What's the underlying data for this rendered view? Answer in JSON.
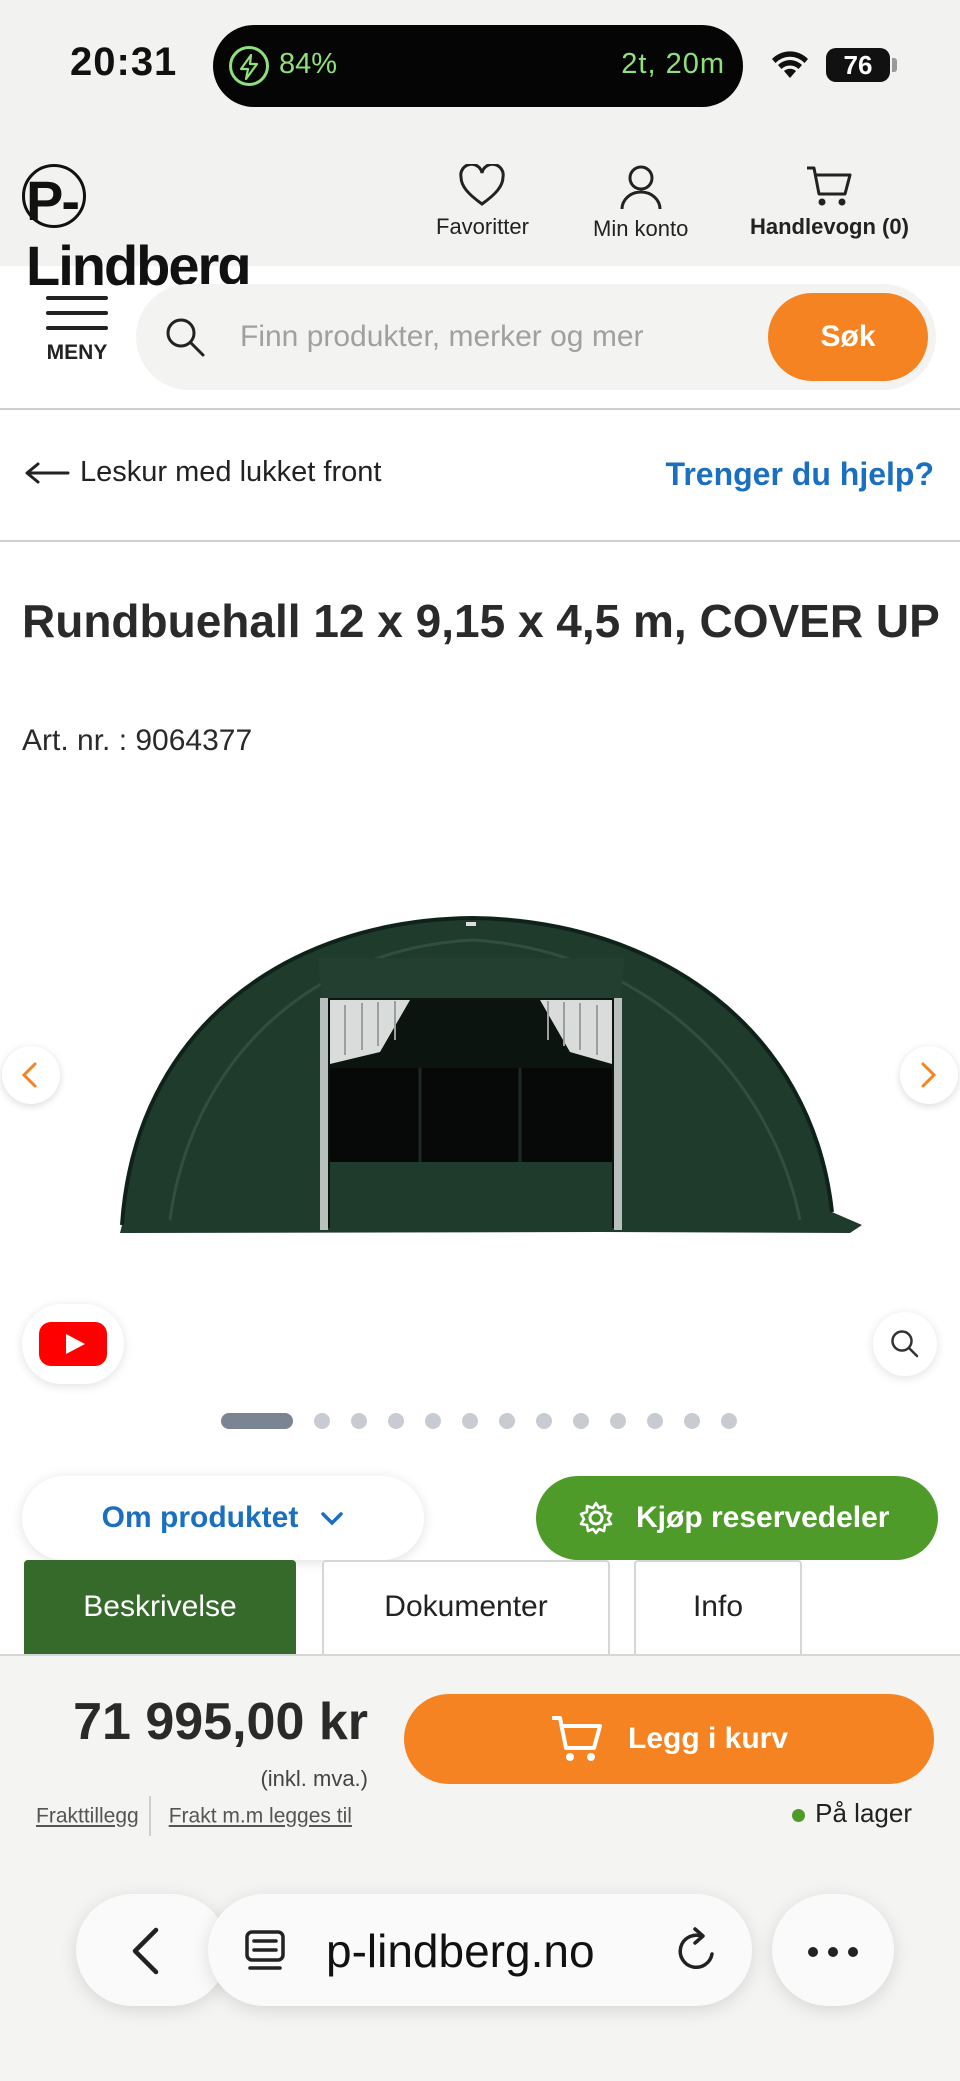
{
  "status_bar": {
    "time": "20:31",
    "activity_battery": "84%",
    "activity_time": "2t, 20m",
    "battery_level": "76"
  },
  "header": {
    "logo": "P-Lindberg",
    "links": [
      {
        "label": "Favoritter",
        "icon": "heart-icon"
      },
      {
        "label": "Min konto",
        "icon": "user-icon"
      },
      {
        "label": "Handlevogn (0)",
        "icon": "cart-icon"
      }
    ]
  },
  "nav": {
    "menu_label": "MENY",
    "search_placeholder": "Finn produkter, merker og mer",
    "search_button": "Søk"
  },
  "breadcrumb": {
    "back_label": "Leskur med lukket front",
    "help_link": "Trenger du hjelp?"
  },
  "product": {
    "title": "Rundbuehall 12 x 9,15 x 4,5 m, COVER UP",
    "art_nr": "Art. nr. : 9064377",
    "image_count": 13,
    "active_image": 1
  },
  "actions": {
    "about_button": "Om produktet",
    "spare_parts_button": "Kjøp reservedeler"
  },
  "tabs": [
    "Beskrivelse",
    "Dokumenter",
    "Info"
  ],
  "buy": {
    "price": "71 995,00 kr",
    "vat_note": "(inkl. mva.)",
    "freight_link_1": "Frakttillegg",
    "freight_link_2": "Frakt m.m legges til",
    "add_to_cart": "Legg i kurv",
    "stock": "På lager"
  },
  "browser": {
    "url": "p-lindberg.no"
  },
  "colors": {
    "brand_orange": "#f68322",
    "link_blue": "#1b6fc0",
    "green": "#4e9b2a",
    "tab_active": "#356a2b"
  }
}
